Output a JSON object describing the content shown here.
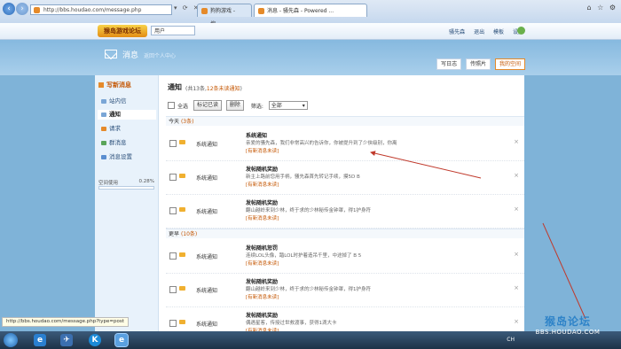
{
  "browser": {
    "address": "http://bbs.houdao.com/message.php",
    "tabs": [
      {
        "label": "狗狗游戏 - 搜...",
        "active": false
      },
      {
        "label": "消息 - 骚先森 - Powered ...",
        "active": true
      }
    ]
  },
  "topbar": {
    "logo": "猴岛游戏论坛",
    "user_select": "用户",
    "links": [
      "骚先森",
      "退出",
      "模板",
      "设置"
    ]
  },
  "header": {
    "title": "消息",
    "subtitle": "返回个人中心",
    "buttons": [
      "写日志",
      "传照片",
      "我的空间"
    ]
  },
  "sidebar": {
    "compose": "写新消息",
    "items": [
      {
        "label": "站内信",
        "active": false,
        "color": "#7aa6d6"
      },
      {
        "label": "通知",
        "active": true,
        "color": "#7aa6d6"
      },
      {
        "label": "请求",
        "active": false,
        "color": "#e58a2a"
      },
      {
        "label": "群消息",
        "active": false,
        "color": "#5aa55a"
      },
      {
        "label": "消息设置",
        "active": false,
        "color": "#5a8ed0"
      }
    ],
    "space_label": "空间使用",
    "space_percent": "0.28%"
  },
  "content": {
    "title": "通知",
    "count_prefix": "(共13条,",
    "count_unread": "12条未读通知",
    "count_suffix": ")",
    "toolbar": {
      "select_all": "全选",
      "mark_read": "标记已读",
      "delete": "删除",
      "filter_label": "筛选:",
      "filter_value": "全部"
    },
    "groups": [
      {
        "label": "今天",
        "count": "(3条)"
      },
      {
        "label": "更早",
        "count": "(10条)"
      }
    ],
    "messages": [
      {
        "source": "系统通知",
        "title": "系统通知",
        "body": "亲爱的骚先森，我们非常高兴的告诉你，你被提升到了少侠级别，你离",
        "link": "[有新消息未读]"
      },
      {
        "source": "系统通知",
        "title": "发帖随机奖励",
        "body": "新主上路前您用手柄，骚先森首先转记手续，摸5D B",
        "link": "[有新消息未读]"
      },
      {
        "source": "系统通知",
        "title": "发帖随机奖励",
        "body": "翻山越岭来到少林，终于求的少林秘传金钟罩，得1护身符",
        "link": "[有新消息未读]"
      },
      {
        "source": "系统通知",
        "title": "发帖随机惩罚",
        "body": "连续LOL头像，踏LOL时护着造吊千里，中途掉了 B 5",
        "link": "[有新消息未读]"
      },
      {
        "source": "系统通知",
        "title": "发帖随机奖励",
        "body": "翻山越岭来到少林，终于求的少林秘传金钟罩，得1护身符",
        "link": "[有新消息未读]"
      },
      {
        "source": "系统通知",
        "title": "发帖随机奖励",
        "body": "偶遇星客，传授过世救渡事，获得1滴大卡",
        "link": "[有新消息未读]"
      }
    ]
  },
  "statusbar": "http://bbs.houdao.com/message.php?type=post",
  "taskbar": {
    "tray_text": "CH"
  },
  "watermark": {
    "title": "猴岛论坛",
    "url": "BBS.HOUDAO.COM"
  },
  "colors": {
    "accent": "#e58a2a",
    "link_blue": "#2a4f7a",
    "annotation": "#c0392b"
  }
}
